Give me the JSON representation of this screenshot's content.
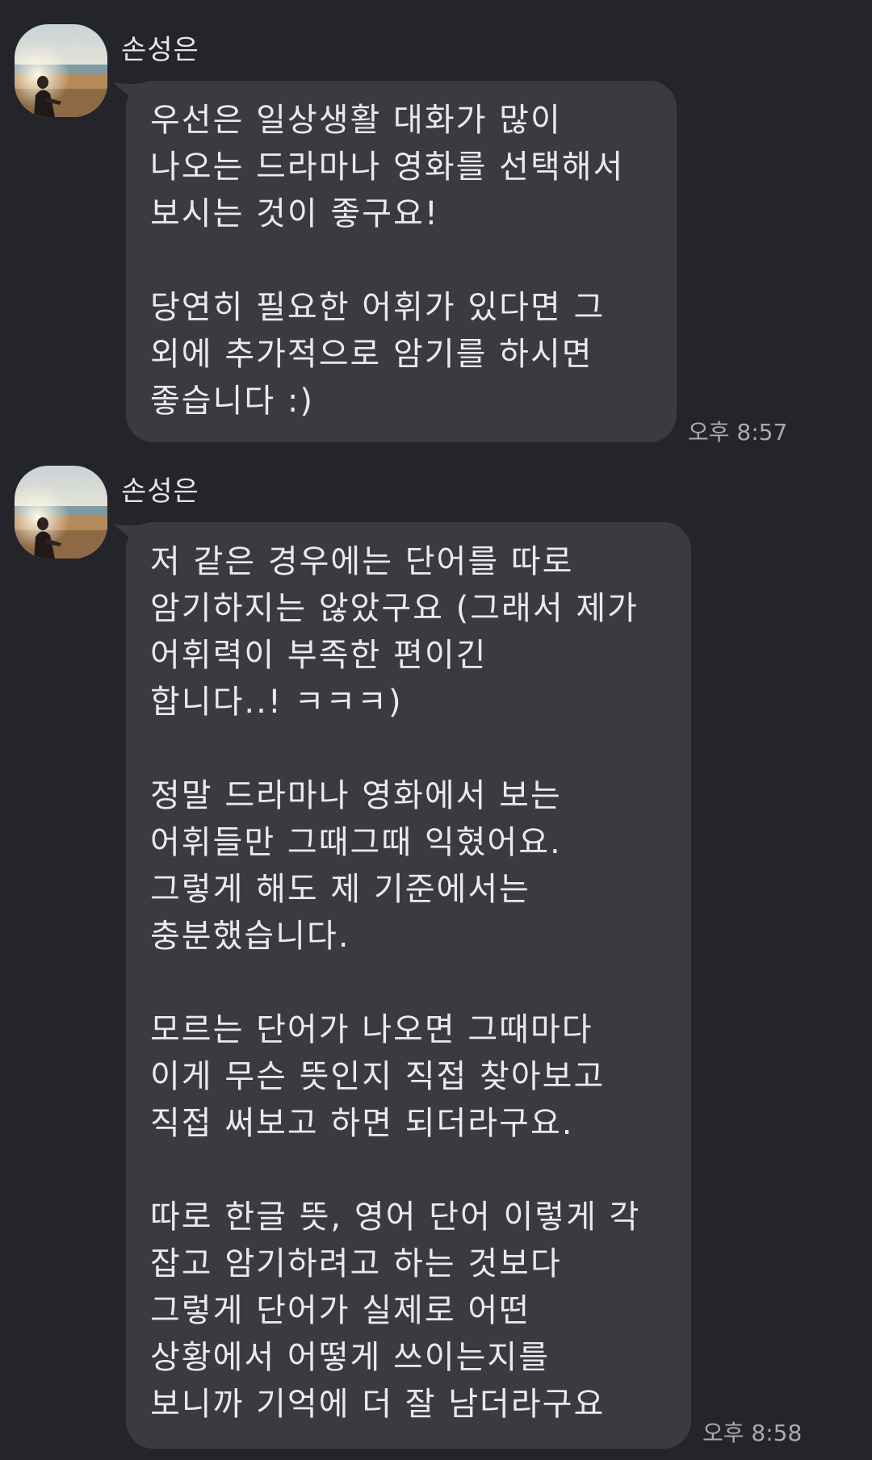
{
  "messages": [
    {
      "sender": "손성은",
      "paragraphs": [
        "우선은 일상생활 대화가 많이\n나오는 드라마나 영화를 선택해서\n보시는 것이 좋구요!",
        "당연히 필요한 어휘가 있다면 그\n외에 추가적으로 암기를 하시면\n좋습니다 :)"
      ],
      "time": "오후 8:57"
    },
    {
      "sender": "손성은",
      "paragraphs": [
        "저 같은 경우에는 단어를 따로\n암기하지는 않았구요 (그래서 제가\n어휘력이 부족한 편이긴\n합니다..! ㅋㅋㅋ)",
        "정말 드라마나 영화에서 보는\n어휘들만 그때그때 익혔어요.\n그렇게 해도 제 기준에서는\n충분했습니다.",
        "모르는 단어가 나오면 그때마다\n이게 무슨 뜻인지 직접 찾아보고\n직접 써보고 하면 되더라구요.",
        "따로 한글 뜻, 영어 단어 이렇게 각\n잡고 암기하려고 하는 것보다\n그렇게 단어가 실제로 어떤\n상황에서 어떻게 쓰이는지를\n보니까 기억에 더 잘 남더라구요"
      ],
      "time": "오후 8:58"
    }
  ],
  "colors": {
    "background": "#24252a",
    "bubble": "#3a3b40",
    "text": "#e9eaee",
    "time": "#a9abb2"
  },
  "icons": {
    "avatar": "beach-photo-avatar"
  }
}
